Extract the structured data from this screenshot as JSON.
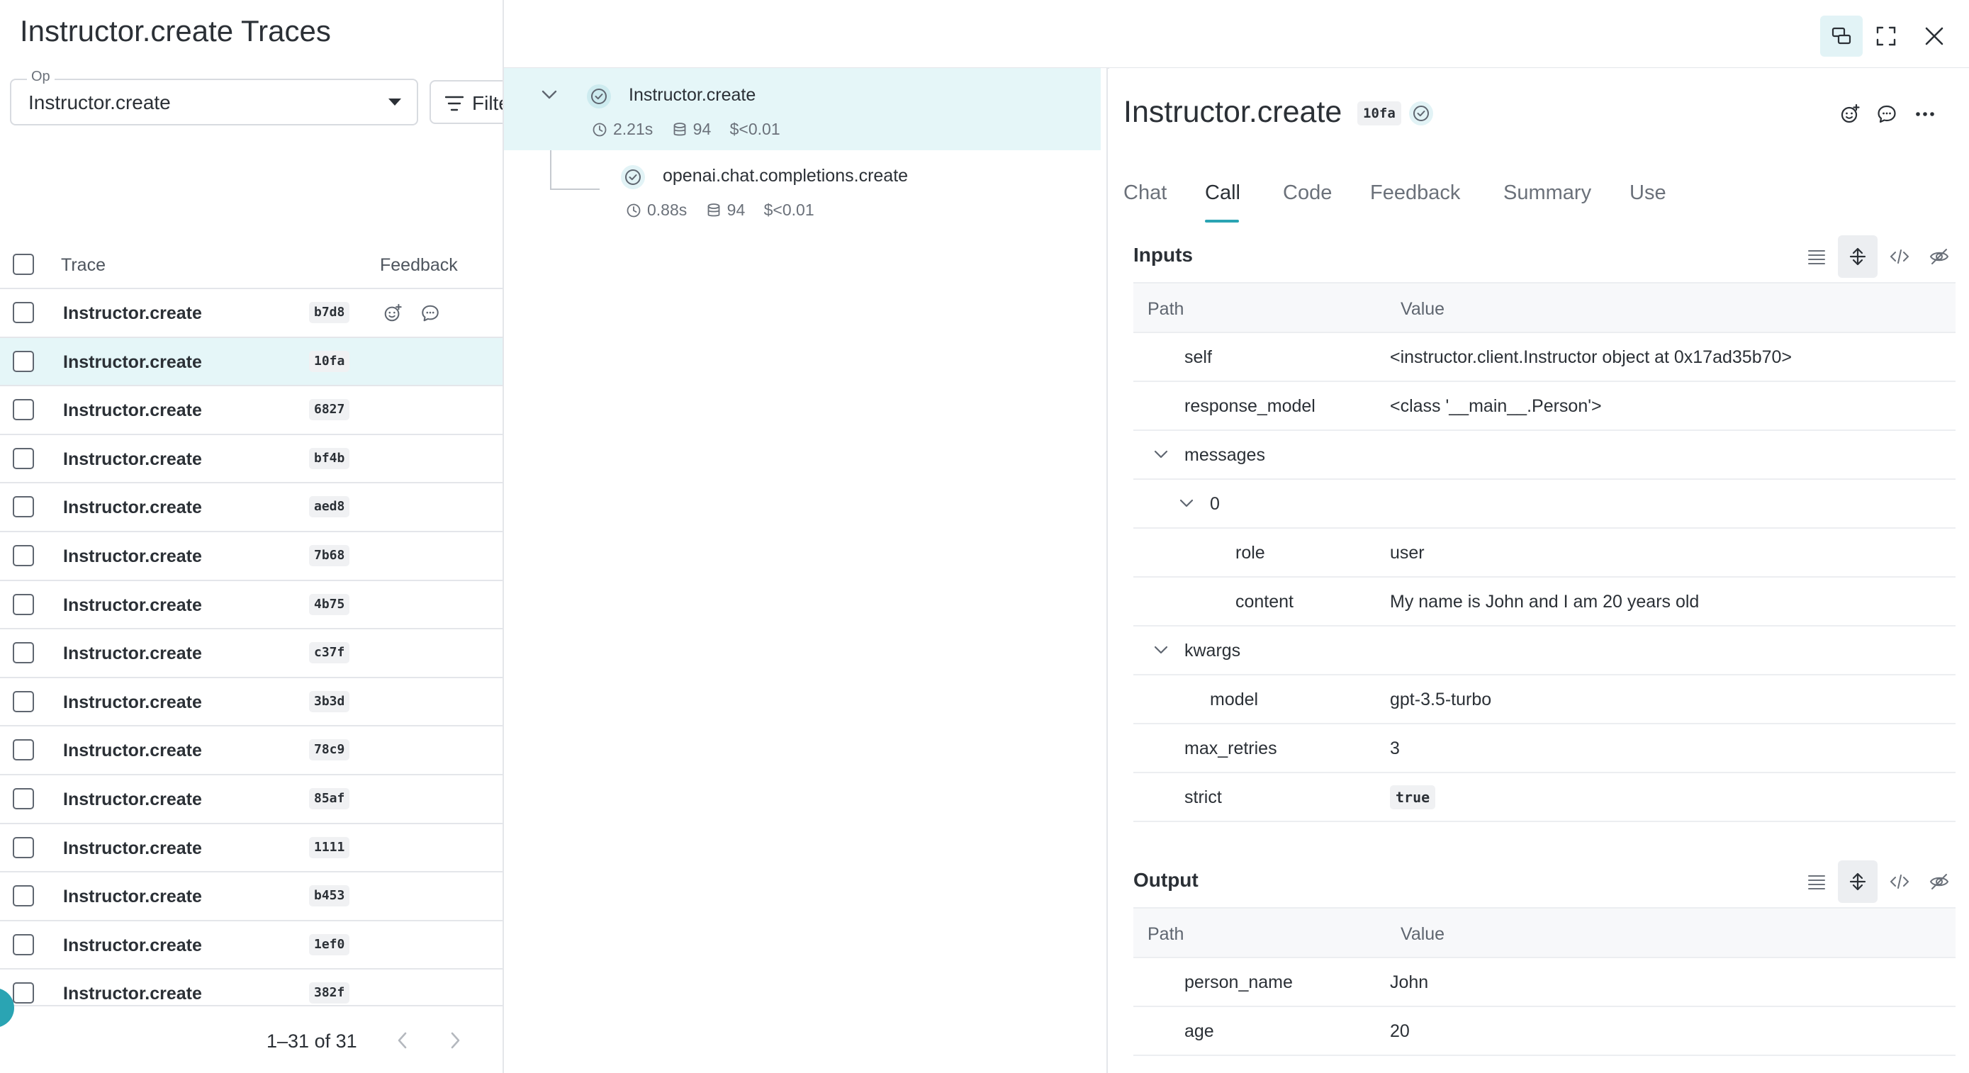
{
  "page": {
    "title": "Instructor.create Traces"
  },
  "op_filter": {
    "label": "Op",
    "value": "Instructor.create"
  },
  "filter": {
    "label": "Filter"
  },
  "table": {
    "headers": {
      "trace": "Trace",
      "feedback": "Feedback"
    },
    "rows": [
      {
        "name": "Instructor.create",
        "id": "b7d8",
        "selected": false
      },
      {
        "name": "Instructor.create",
        "id": "10fa",
        "selected": true
      },
      {
        "name": "Instructor.create",
        "id": "6827",
        "selected": false
      },
      {
        "name": "Instructor.create",
        "id": "bf4b",
        "selected": false
      },
      {
        "name": "Instructor.create",
        "id": "aed8",
        "selected": false
      },
      {
        "name": "Instructor.create",
        "id": "7b68",
        "selected": false
      },
      {
        "name": "Instructor.create",
        "id": "4b75",
        "selected": false
      },
      {
        "name": "Instructor.create",
        "id": "c37f",
        "selected": false
      },
      {
        "name": "Instructor.create",
        "id": "3b3d",
        "selected": false
      },
      {
        "name": "Instructor.create",
        "id": "78c9",
        "selected": false
      },
      {
        "name": "Instructor.create",
        "id": "85af",
        "selected": false
      },
      {
        "name": "Instructor.create",
        "id": "1111",
        "selected": false
      },
      {
        "name": "Instructor.create",
        "id": "b453",
        "selected": false
      },
      {
        "name": "Instructor.create",
        "id": "1ef0",
        "selected": false
      },
      {
        "name": "Instructor.create",
        "id": "382f",
        "selected": false
      }
    ]
  },
  "pagination": {
    "text": "1–31 of 31"
  },
  "trace_tree": {
    "root": {
      "name": "Instructor.create",
      "duration": "2.21s",
      "tokens": "94",
      "cost": "$<0.01"
    },
    "child": {
      "name": "openai.chat.completions.create",
      "duration": "0.88s",
      "tokens": "94",
      "cost": "$<0.01"
    }
  },
  "call": {
    "title": "Instructor.create",
    "id": "10fa",
    "tabs": [
      "Chat",
      "Call",
      "Code",
      "Feedback",
      "Summary",
      "Use"
    ],
    "active_tab": "Call"
  },
  "inputs": {
    "title": "Inputs",
    "path_header": "Path",
    "value_header": "Value",
    "rows": [
      {
        "key": "self",
        "value": "<instructor.client.Instructor object at 0x17ad35b70>",
        "depth": 0,
        "expandable": false
      },
      {
        "key": "response_model",
        "value": "<class '__main__.Person'>",
        "depth": 0,
        "expandable": false
      },
      {
        "key": "messages",
        "value": "",
        "depth": 0,
        "expandable": true
      },
      {
        "key": "0",
        "value": "",
        "depth": 1,
        "expandable": true
      },
      {
        "key": "role",
        "value": "user",
        "depth": 2,
        "expandable": false
      },
      {
        "key": "content",
        "value": "My name is John and I am 20 years old",
        "depth": 2,
        "expandable": false
      },
      {
        "key": "kwargs",
        "value": "",
        "depth": 0,
        "expandable": true
      },
      {
        "key": "model",
        "value": "gpt-3.5-turbo",
        "depth": 1,
        "expandable": false
      },
      {
        "key": "max_retries",
        "value": "3",
        "depth": 0,
        "expandable": false
      },
      {
        "key": "strict",
        "value": "true",
        "depth": 0,
        "expandable": false,
        "pill": true
      }
    ]
  },
  "output": {
    "title": "Output",
    "path_header": "Path",
    "value_header": "Value",
    "rows": [
      {
        "key": "person_name",
        "value": "John",
        "depth": 0,
        "expandable": false
      },
      {
        "key": "age",
        "value": "20",
        "depth": 0,
        "expandable": false
      }
    ]
  },
  "colors": {
    "accent": "#2aa4b3",
    "selected_row": "#e5f6f8",
    "success": "#2aa4b3"
  }
}
